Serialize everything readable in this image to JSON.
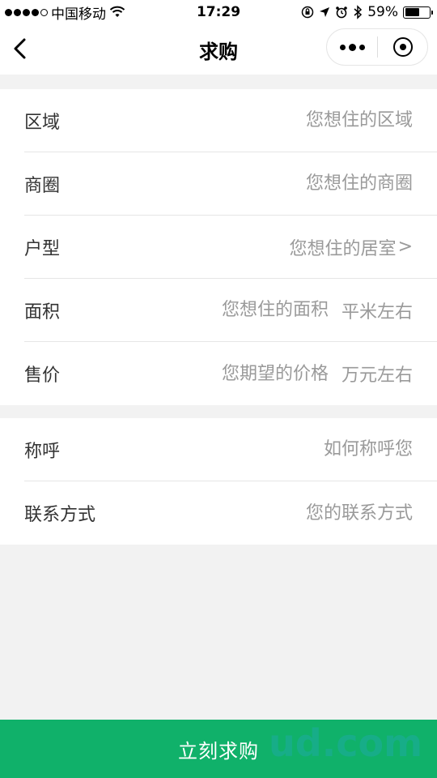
{
  "status_bar": {
    "carrier": "中国移动",
    "time": "17:29",
    "battery": "59%",
    "battery_level": 0.59
  },
  "nav": {
    "title": "求购"
  },
  "form": {
    "group1": [
      {
        "label": "区域",
        "placeholder": "您想住的区域"
      },
      {
        "label": "商圈",
        "placeholder": "您想住的商圈"
      },
      {
        "label": "户型",
        "placeholder": "您想住的居室",
        "chevron": ">"
      },
      {
        "label": "面积",
        "placeholder": "您想住的面积",
        "unit": "平米左右"
      },
      {
        "label": "售价",
        "placeholder": "您期望的价格",
        "unit": "万元左右"
      }
    ],
    "group2": [
      {
        "label": "称呼",
        "placeholder": "如何称呼您"
      },
      {
        "label": "联系方式",
        "placeholder": "您的联系方式"
      }
    ]
  },
  "submit": {
    "label": "立刻求购"
  },
  "watermark": {
    "text": "ud.com"
  },
  "colors": {
    "accent": "#10b16a",
    "background": "#f2f2f2",
    "placeholder": "#9a9a9a"
  }
}
